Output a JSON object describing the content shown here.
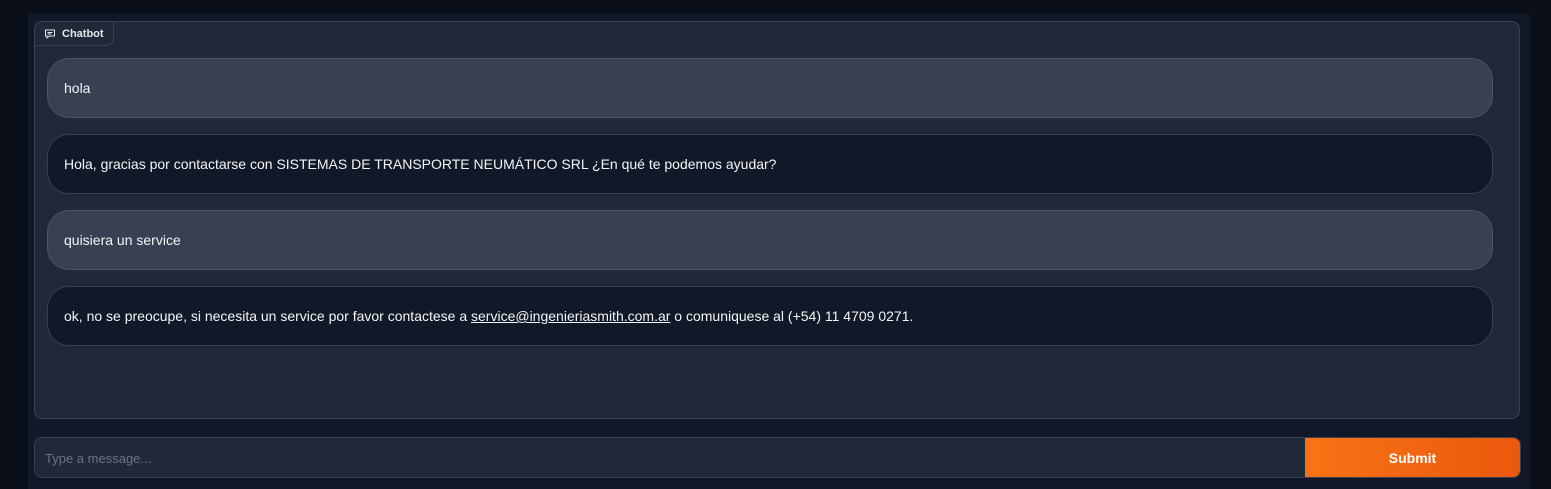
{
  "chatbot": {
    "label": "Chatbot",
    "icon": "chat-icon",
    "messages": [
      {
        "role": "user",
        "text": "hola"
      },
      {
        "role": "bot",
        "text": "Hola, gracias por contactarse con SISTEMAS DE TRANSPORTE NEUMÁTICO SRL ¿En qué te podemos ayudar?"
      },
      {
        "role": "user",
        "text": "quisiera un service"
      },
      {
        "role": "bot",
        "text_before": "ok, no se preocupe, si necesita un service por favor contactese a ",
        "link": "service@ingenieriasmith.com.ar",
        "text_after": " o comuniquese al (+54) 11 4709 0271."
      }
    ]
  },
  "input": {
    "value": "",
    "placeholder": "Type a message..."
  },
  "submit": {
    "label": "Submit"
  },
  "colors": {
    "background": "#0b0f19",
    "panel": "#1f2937",
    "user_bubble": "#374151",
    "bot_bubble": "#111827",
    "accent": "#f97316"
  }
}
